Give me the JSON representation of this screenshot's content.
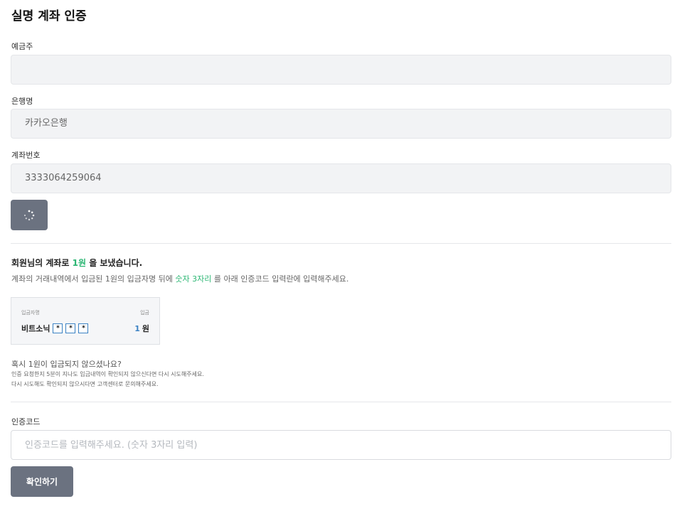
{
  "page_title": "실명 계좌 인증",
  "fields": {
    "holder": {
      "label": "예금주",
      "value": ""
    },
    "bank": {
      "label": "은행명",
      "value": "카카오은행"
    },
    "account": {
      "label": "계좌번호",
      "value": "3333064259064"
    }
  },
  "spinner_icon": "loading-spinner-icon",
  "sent": {
    "title_before": "회원님의 계좌로 ",
    "title_amount": "1원",
    "title_after": " 을 보냈습니다.",
    "desc_before": "계좌의 거래내역에서 입금된 1원의 입금자명 뒤에 ",
    "desc_highlight": "숫자 3자리",
    "desc_after": " 를 아래 인증코드 입력란에 입력해주세요."
  },
  "card": {
    "label_left": "입금자명",
    "label_right": "입금",
    "name": "비트소닉",
    "masks": [
      "*",
      "*",
      "*"
    ],
    "amount_num": "1",
    "amount_unit": "원"
  },
  "help": {
    "question": "혹시 1원이 입금되지 않으셨나요?",
    "line1": "인증 요청한지 5분이 지나도 입금내역이 확인되지 않으신다면 다시 시도해주세요.",
    "line2": "다시 시도해도 확인되지 않으시다면 고객센터로 문의해주세요."
  },
  "code": {
    "label": "인증코드",
    "placeholder": "인증코드를 입력해주세요. (숫자 3자리 입력)",
    "value": ""
  },
  "confirm_label": "확인하기",
  "colors": {
    "accent_green": "#2bb673",
    "accent_blue": "#3b82c4",
    "button_gray": "#6b7280"
  }
}
